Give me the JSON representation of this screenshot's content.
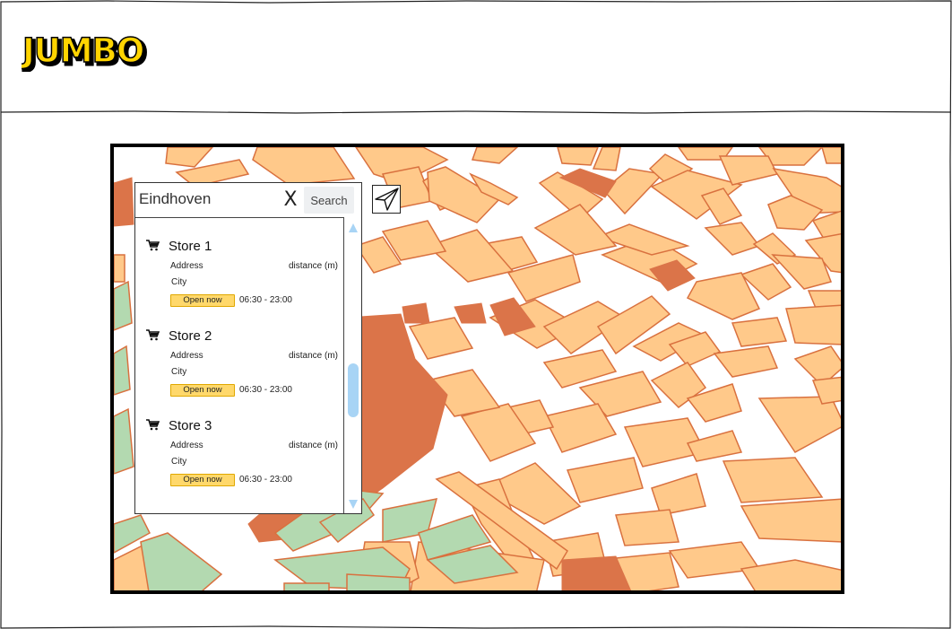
{
  "brand": {
    "logo_text": "JUMBO",
    "logo_color": "#ffd400"
  },
  "colors": {
    "block": "#ffc98a",
    "block_stroke": "#d9713f",
    "landmark": "#db7449",
    "park": "#b3d9b0",
    "park_stroke": "#d9713f",
    "badge": "#ffd86b",
    "scroll_thumb": "#a8d4f5"
  },
  "search": {
    "value": "Eindhoven",
    "clear_label": "X",
    "button_label": "Search"
  },
  "locate": {
    "icon": "paper-plane-icon"
  },
  "stores": [
    {
      "name": "Store 1",
      "address": "Address",
      "distance": "distance (m)",
      "city": "City",
      "status": "Open now",
      "hours": "06:30 - 23:00"
    },
    {
      "name": "Store 2",
      "address": "Address",
      "distance": "distance (m)",
      "city": "City",
      "status": "Open now",
      "hours": "06:30 - 23:00"
    },
    {
      "name": "Store 3",
      "address": "Address",
      "distance": "distance (m)",
      "city": "City",
      "status": "Open now",
      "hours": "06:30 - 23:00"
    }
  ],
  "scrollbar": {
    "position": 0.62
  }
}
